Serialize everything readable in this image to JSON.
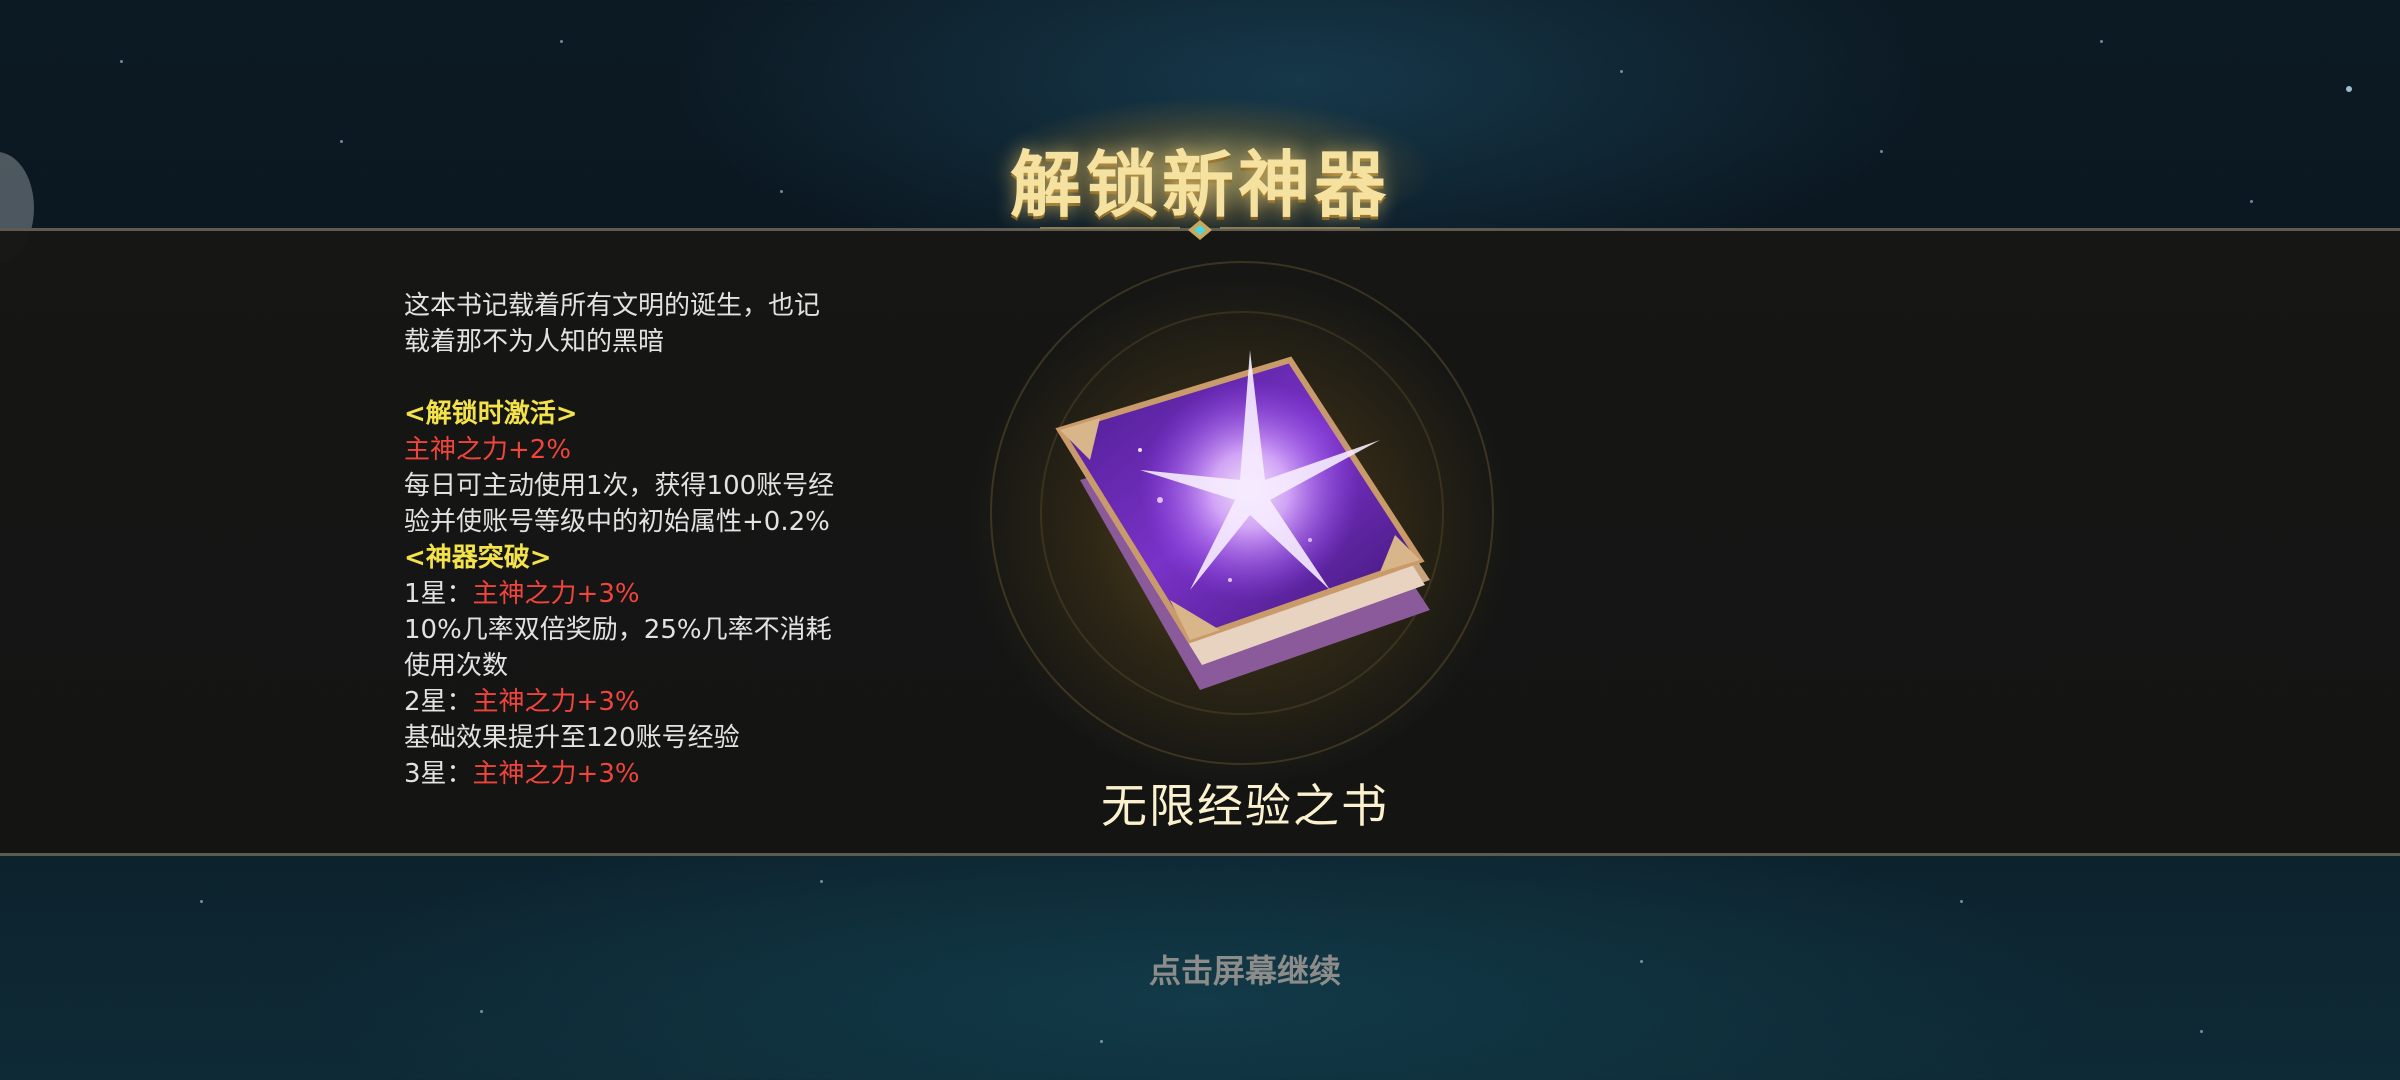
{
  "title": "解锁新神器",
  "description": {
    "line1": "这本书记载着所有文明的诞生，也记",
    "line2": "载着那不为人知的黑暗"
  },
  "unlock_section": {
    "header": "<解锁时激活>",
    "stat": "主神之力+2%",
    "effect_line1": "每日可主动使用1次，获得100账号经",
    "effect_line2": "验并使账号等级中的初始属性+0.2%"
  },
  "breakthrough_section": {
    "header": "<神器突破>",
    "star1_label": "1星：",
    "star1_stat": "主神之力+3%",
    "star1_effect_line1": "10%几率双倍奖励，25%几率不消耗",
    "star1_effect_line2": "使用次数",
    "star2_label": "2星：",
    "star2_stat": "主神之力+3%",
    "star2_effect": "基础效果提升至120账号经验",
    "star3_label": "3星：",
    "star3_stat": "主神之力+3%"
  },
  "artifact": {
    "name": "无限经验之书",
    "icon": "purple-spellbook-icon"
  },
  "continue_prompt": "点击屏幕继续",
  "colors": {
    "title": "#f6e2a0",
    "section_header": "#f4e24a",
    "stat": "#f0443c",
    "body_text": "#e2e2e2"
  }
}
